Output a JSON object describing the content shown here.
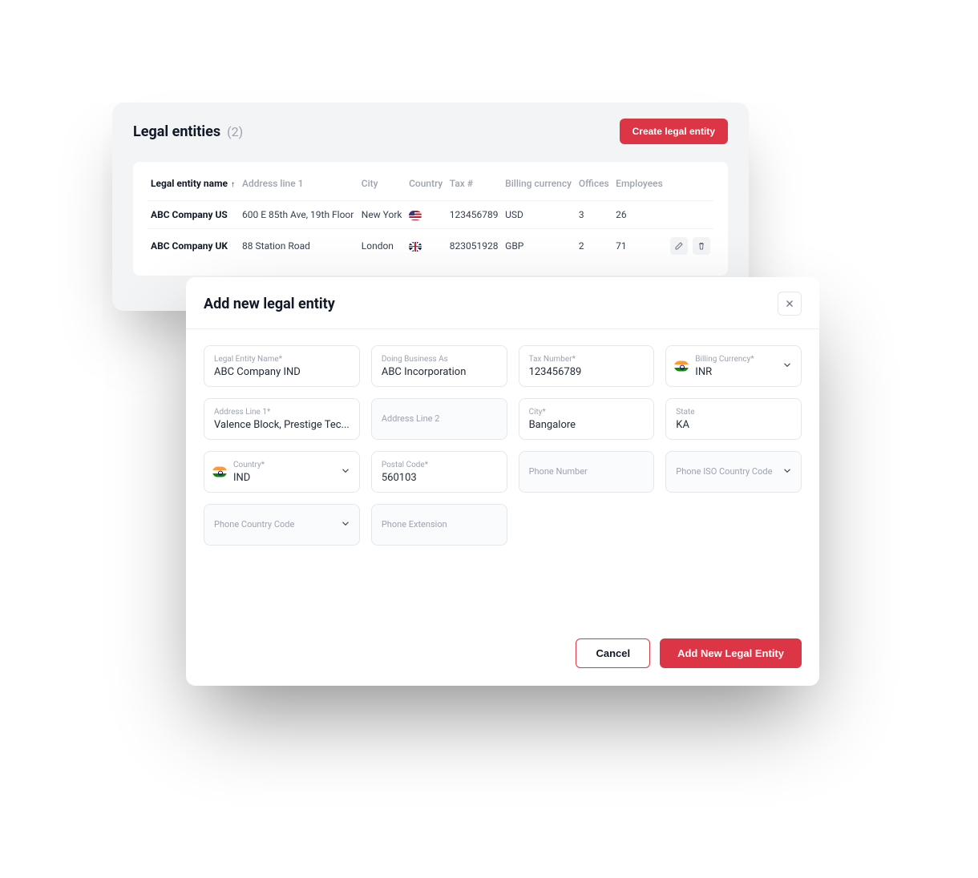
{
  "colors": {
    "accent": "#dc3545"
  },
  "back": {
    "title": "Legal entities",
    "count": "(2)",
    "create_button": "Create legal entity",
    "columns": {
      "name": "Legal entity name",
      "addr1": "Address line 1",
      "city": "City",
      "country": "Country",
      "tax": "Tax #",
      "currency": "Billing currency",
      "offices": "Offices",
      "employees": "Employees"
    },
    "sort_indicator": "↑",
    "rows": [
      {
        "name": "ABC Company US",
        "addr1": "600 E 85th Ave, 19th Floor",
        "city": "New York",
        "country_flag": "us",
        "tax": "123456789",
        "currency": "USD",
        "offices": "3",
        "employees": "26"
      },
      {
        "name": "ABC Company UK",
        "addr1": "88 Station Road",
        "city": "London",
        "country_flag": "uk",
        "tax": "823051928",
        "currency": "GBP",
        "offices": "2",
        "employees": "71"
      }
    ]
  },
  "modal": {
    "title": "Add new legal entity",
    "fields": {
      "legal_entity_name": {
        "label": "Legal Entity Name*",
        "value": "ABC Company IND"
      },
      "dba": {
        "label": "Doing Business As",
        "value": "ABC Incorporation"
      },
      "tax_number": {
        "label": "Tax Number*",
        "value": "123456789"
      },
      "billing_currency": {
        "label": "Billing Currency*",
        "value": "INR",
        "flag": "in"
      },
      "addr1": {
        "label": "Address Line 1*",
        "value": "Valence Block, Prestige Tec..."
      },
      "addr2": {
        "label": "Address Line 2",
        "value": ""
      },
      "city": {
        "label": "City*",
        "value": "Bangalore"
      },
      "state": {
        "label": "State",
        "value": "KA"
      },
      "country": {
        "label": "Country*",
        "value": "IND",
        "flag": "in"
      },
      "postal": {
        "label": "Postal Code*",
        "value": "560103"
      },
      "phone": {
        "label": "Phone Number",
        "value": ""
      },
      "phone_iso": {
        "label": "Phone ISO Country Code",
        "value": ""
      },
      "phone_cc": {
        "label": "Phone Country Code",
        "value": ""
      },
      "phone_ext": {
        "label": "Phone Extension",
        "value": ""
      }
    },
    "buttons": {
      "cancel": "Cancel",
      "submit": "Add New Legal Entity"
    }
  }
}
